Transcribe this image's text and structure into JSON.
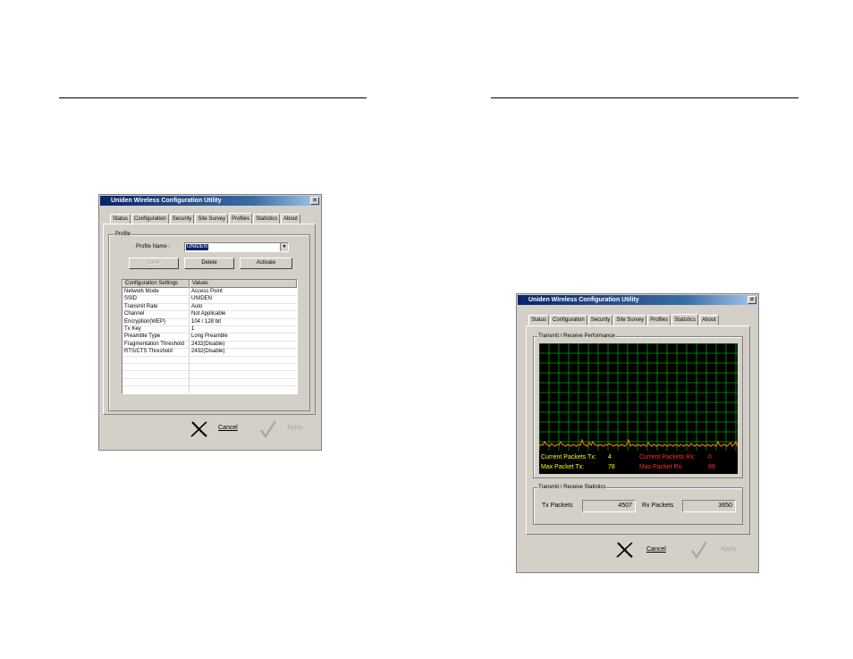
{
  "colors": {
    "titlebar_start": "#0a246a",
    "titlebar_end": "#a6caf0",
    "window_face": "#d4d0c8",
    "graph_background": "#000000",
    "graph_grid": "#00a000",
    "tx_color": "#ffff00",
    "rx_color": "#ff3030",
    "trace_color": "#ff8000"
  },
  "left_window": {
    "title": "Uniden Wireless Configuration Utility",
    "close": "✕",
    "tabs": [
      {
        "label": "Status",
        "active": false
      },
      {
        "label": "Configuration",
        "active": false
      },
      {
        "label": "Security",
        "active": false
      },
      {
        "label": "Site Survey",
        "active": false
      },
      {
        "label": "Profiles",
        "active": true
      },
      {
        "label": "Statistics",
        "active": false
      },
      {
        "label": "About",
        "active": false
      }
    ],
    "profile_group": "Profile",
    "profile_name_label": "Profile Name :",
    "profile_name_value": "UNIDEN",
    "combo_arrow": "▼",
    "buttons": {
      "save": "Save",
      "delete": "Delete",
      "activate": "Activate"
    },
    "table": {
      "headers": [
        "Configuration Settings",
        "Values"
      ],
      "rows": [
        [
          "Network Mode",
          "Access Point"
        ],
        [
          "SSID",
          "UNIDEN"
        ],
        [
          "Transmit Rate",
          "Auto"
        ],
        [
          "Channel",
          "Not Applicable"
        ],
        [
          "Encryption(WEP)",
          "104 / 128 bit"
        ],
        [
          "Tx Key",
          "1"
        ],
        [
          "Preamble Type",
          "Long Preamble"
        ],
        [
          "Fragmentation Threshold",
          "2432(Disable)"
        ],
        [
          "RTS/CTS Threshold",
          "2432(Disable)"
        ],
        [
          "",
          ""
        ],
        [
          "",
          ""
        ],
        [
          "",
          ""
        ],
        [
          "",
          ""
        ],
        [
          "",
          ""
        ]
      ]
    },
    "footer": {
      "cancel": "Cancel",
      "apply": "Apply"
    }
  },
  "right_window": {
    "title": "Uniden Wireless Configuration Utility",
    "close": "✕",
    "tabs": [
      {
        "label": "Status",
        "active": false
      },
      {
        "label": "Configuration",
        "active": false
      },
      {
        "label": "Security",
        "active": false
      },
      {
        "label": "Site Survey",
        "active": false
      },
      {
        "label": "Profiles",
        "active": false
      },
      {
        "label": "Statistics",
        "active": true
      },
      {
        "label": "About",
        "active": false
      }
    ],
    "performance_group": "Transmit / Receive Performance",
    "graph_stats": {
      "current_tx_label": "Current Packets Tx:",
      "current_tx_value": "4",
      "current_rx_label": "Current Packets Rx:",
      "current_rx_value": "0",
      "max_tx_label": "Max Packet Tx:",
      "max_tx_value": "78",
      "max_rx_label": "Max Packet Rx:",
      "max_rx_value": "69"
    },
    "statistics_group": "Transmit / Receive Statistics",
    "tx_packets_label": "Tx Packets",
    "tx_packets_value": "4507",
    "rx_packets_label": "Rx Packets",
    "rx_packets_value": "3650",
    "footer": {
      "cancel": "Cancel",
      "apply": "Apply"
    }
  }
}
